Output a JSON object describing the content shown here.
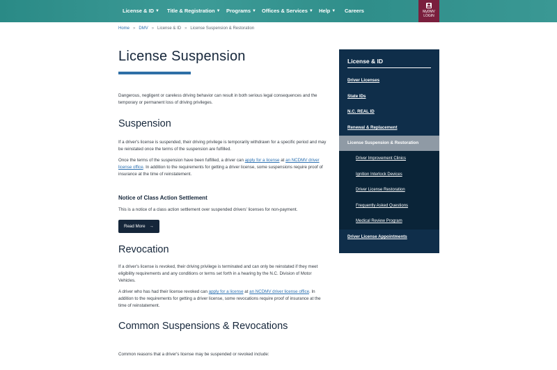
{
  "nav": {
    "items": [
      {
        "label": "License & ID",
        "has_dropdown": true
      },
      {
        "label": "Title & Registration",
        "has_dropdown": true
      },
      {
        "label": "Programs",
        "has_dropdown": true
      },
      {
        "label": "Offices & Services",
        "has_dropdown": true
      },
      {
        "label": "Help",
        "has_dropdown": true
      },
      {
        "label": "Careers",
        "has_dropdown": false
      }
    ],
    "account": {
      "line1": "MyDMV",
      "line2": "LOGIN",
      "icon": "user-icon"
    },
    "colors": {
      "bar": "#2f8e8a",
      "account": "#7a1f3d"
    }
  },
  "breadcrumb": [
    "Home",
    "DMV",
    "License & ID",
    "License Suspension & Restoration"
  ],
  "main": {
    "title": "License Suspension",
    "intro": "Dangerous, negligent or careless driving behavior can result in both serious legal consequences and the temporary or permanent loss of driving privileges.",
    "suspension": {
      "heading": "Suspension",
      "p1": "If a driver's license is suspended, their driving privilege is temporarily withdrawn for a specific period and may be reinstated once the terms of the suspension are fulfilled.",
      "p2_a": "Once the terms of the suspension have been fulfilled, a driver can ",
      "p2_link1": "apply for a license",
      "p2_b": " at ",
      "p2_link2": "an NCDMV driver license office",
      "p2_c": ".  In addition to the requirements for getting a driver license, some suspensions require proof of insurance at the time of reinstatement."
    },
    "notice": {
      "heading": "Notice of Class Action Settlement",
      "text": "This is a notice of a class action settlement over suspended drivers' licenses for non-payment.",
      "button": "Read More",
      "button_icon": "arrow-right-icon"
    },
    "revocation": {
      "heading": "Revocation",
      "p1": "If a driver's license is revoked, their driving privilege is terminated and can only be reinstated if they meet eligibility requirements and any conditions or terms set forth in a hearing by the N.C. Division of Motor Vehicles.",
      "p2_a": "A driver who has had their license revoked can ",
      "p2_link1": "apply for a license",
      "p2_b": " at ",
      "p2_link2": "an NCDMV driver license office",
      "p2_c": ".  In addition to the requirements for getting a driver license, some revocations require proof of insurance at the time of reinstatement."
    },
    "common": {
      "heading": "Common Suspensions & Revocations",
      "text": "Common reasons that a driver's license may be suspended or revoked include:"
    }
  },
  "sidebar": {
    "title": "License & ID",
    "links": [
      "Driver Licenses",
      "State IDs",
      "N.C. REAL ID",
      "Renewal & Replacement"
    ],
    "active": "License Suspension & Restoration",
    "sublinks": [
      "Driver Improvement Clinics",
      "Ignition Interlock Devices",
      "Driver License Restoration",
      "Frequently Asked Questions",
      "Medical Review Program"
    ],
    "last_link": "Driver License Appointments",
    "colors": {
      "panel": "#0f2e4a",
      "active": "#8f9aa5",
      "sub": "#0a2438"
    }
  }
}
